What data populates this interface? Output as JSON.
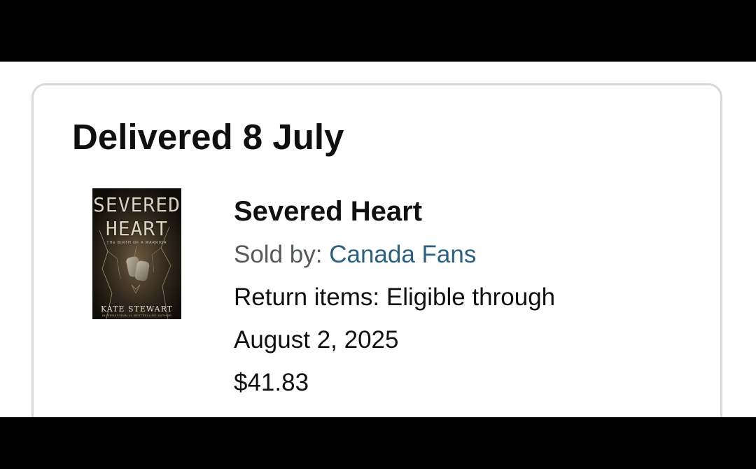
{
  "order": {
    "delivery_status": "Delivered 8 July",
    "item": {
      "title": "Severed Heart",
      "sold_by_label": "Sold by:",
      "seller": "Canada Fans",
      "return_line1": "Return items: Eligible through",
      "return_line2": "August 2, 2025",
      "price": "$41.83",
      "cover": {
        "title_line1": "SEVERED",
        "title_line2": "HEART",
        "subtitle": "THE BIRTH OF A WARRIOR",
        "author": "KATE STEWART",
        "tagline": "INTERNATIONALLY BESTSELLING AUTHOR"
      }
    }
  },
  "colors": {
    "text": "#0f1111",
    "muted": "#565959",
    "link": "#2a6180",
    "card_border": "#d5d9d9"
  }
}
